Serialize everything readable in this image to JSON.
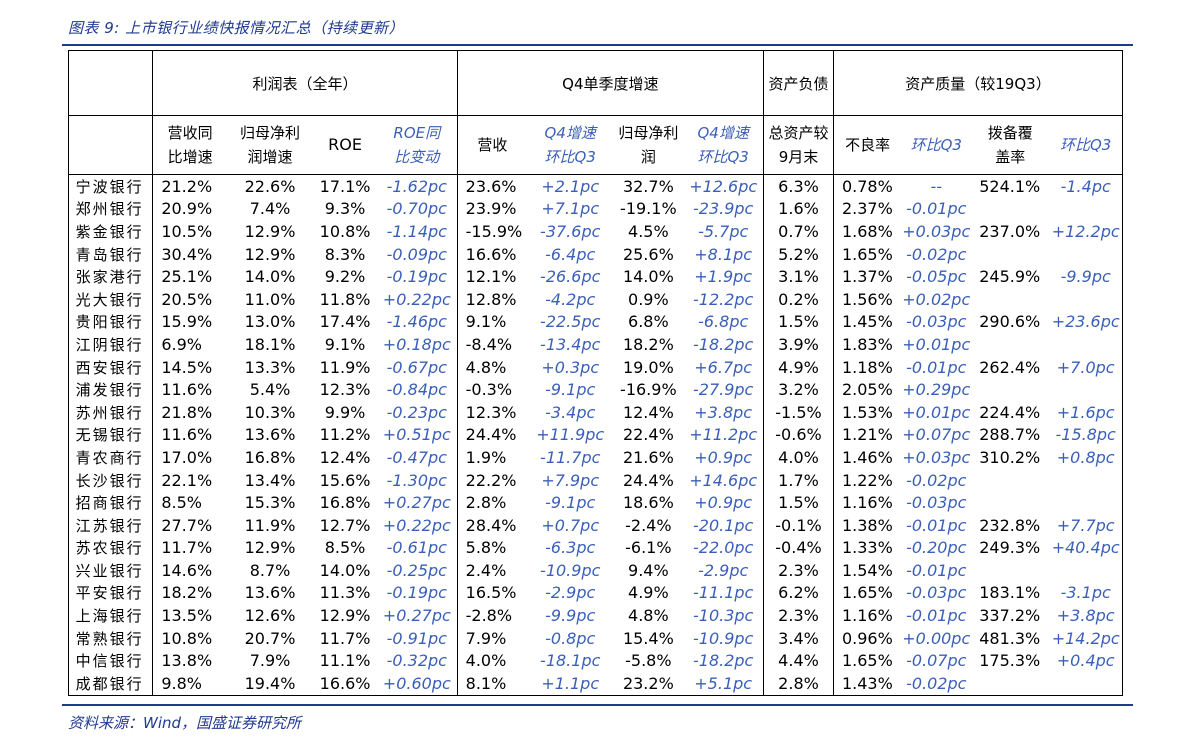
{
  "title": "图表 9:  上市银行业绩快报情况汇总（持续更新）",
  "source": "资料来源：Wind，国盛证券研究所",
  "groups": {
    "profit": "利润表（全年）",
    "q4": "Q4单季度增速",
    "balance": "资产负债",
    "quality": "资产质量（较19Q3）"
  },
  "columns": {
    "rev_yoy_1": "营收同",
    "rev_yoy_2": "比增速",
    "np_yoy_1": "归母净利",
    "np_yoy_2": "润增速",
    "roe": "ROE",
    "roe_yoy_1": "ROE同",
    "roe_yoy_2": "比变动",
    "q4_rev": "营收",
    "q4_rev_qoq_1": "Q4增速",
    "q4_rev_qoq_2": "环比Q3",
    "q4_np_1": "归母净利",
    "q4_np_2": "润",
    "q4_np_qoq_1": "Q4增速",
    "q4_np_qoq_2": "环比Q3",
    "assets_1": "总资产较",
    "assets_2": "9月末",
    "npl": "不良率",
    "npl_qoq": "环比Q3",
    "cov_1": "拨备覆",
    "cov_2": "盖率",
    "cov_qoq": "环比Q3"
  },
  "rows": [
    {
      "bank": "宁波银行",
      "c": [
        "21.2%",
        "22.6%",
        "17.1%",
        "-1.62pc",
        "23.6%",
        "+2.1pc",
        "32.7%",
        "+12.6pc",
        "6.3%",
        "0.78%",
        "--",
        "524.1%",
        "-1.4pc"
      ]
    },
    {
      "bank": "郑州银行",
      "c": [
        "20.9%",
        "7.4%",
        "9.3%",
        "-0.70pc",
        "23.9%",
        "+7.1pc",
        "-19.1%",
        "-23.9pc",
        "1.6%",
        "2.37%",
        "-0.01pc",
        "",
        ""
      ]
    },
    {
      "bank": "紫金银行",
      "c": [
        "10.5%",
        "12.9%",
        "10.8%",
        "-1.14pc",
        "-15.9%",
        "-37.6pc",
        "4.5%",
        "-5.7pc",
        "0.7%",
        "1.68%",
        "+0.03pc",
        "237.0%",
        "+12.2pc"
      ]
    },
    {
      "bank": "青岛银行",
      "c": [
        "30.4%",
        "12.9%",
        "8.3%",
        "-0.09pc",
        "16.6%",
        "-6.4pc",
        "25.6%",
        "+8.1pc",
        "5.2%",
        "1.65%",
        "-0.02pc",
        "",
        ""
      ]
    },
    {
      "bank": "张家港行",
      "c": [
        "25.1%",
        "14.0%",
        "9.2%",
        "-0.19pc",
        "12.1%",
        "-26.6pc",
        "14.0%",
        "+1.9pc",
        "3.1%",
        "1.37%",
        "-0.05pc",
        "245.9%",
        "-9.9pc"
      ]
    },
    {
      "bank": "光大银行",
      "c": [
        "20.5%",
        "11.0%",
        "11.8%",
        "+0.22pc",
        "12.8%",
        "-4.2pc",
        "0.9%",
        "-12.2pc",
        "0.2%",
        "1.56%",
        "+0.02pc",
        "",
        ""
      ]
    },
    {
      "bank": "贵阳银行",
      "c": [
        "15.9%",
        "13.0%",
        "17.4%",
        "-1.46pc",
        "9.1%",
        "-22.5pc",
        "6.8%",
        "-6.8pc",
        "1.5%",
        "1.45%",
        "-0.03pc",
        "290.6%",
        "+23.6pc"
      ]
    },
    {
      "bank": "江阴银行",
      "c": [
        "6.9%",
        "18.1%",
        "9.1%",
        "+0.18pc",
        "-8.4%",
        "-13.4pc",
        "18.2%",
        "-18.2pc",
        "3.9%",
        "1.83%",
        "+0.01pc",
        "",
        ""
      ]
    },
    {
      "bank": "西安银行",
      "c": [
        "14.5%",
        "13.3%",
        "11.9%",
        "-0.67pc",
        "4.8%",
        "+0.3pc",
        "19.0%",
        "+6.7pc",
        "4.9%",
        "1.18%",
        "-0.01pc",
        "262.4%",
        "+7.0pc"
      ]
    },
    {
      "bank": "浦发银行",
      "c": [
        "11.6%",
        "5.4%",
        "12.3%",
        "-0.84pc",
        "-0.3%",
        "-9.1pc",
        "-16.9%",
        "-27.9pc",
        "3.2%",
        "2.05%",
        "+0.29pc",
        "",
        ""
      ]
    },
    {
      "bank": "苏州银行",
      "c": [
        "21.8%",
        "10.3%",
        "9.9%",
        "-0.23pc",
        "12.3%",
        "-3.4pc",
        "12.4%",
        "+3.8pc",
        "-1.5%",
        "1.53%",
        "+0.01pc",
        "224.4%",
        "+1.6pc"
      ]
    },
    {
      "bank": "无锡银行",
      "c": [
        "11.6%",
        "13.6%",
        "11.2%",
        "+0.51pc",
        "24.4%",
        "+11.9pc",
        "22.4%",
        "+11.2pc",
        "-0.6%",
        "1.21%",
        "+0.07pc",
        "288.7%",
        "-15.8pc"
      ]
    },
    {
      "bank": "青农商行",
      "c": [
        "17.0%",
        "16.8%",
        "12.4%",
        "-0.47pc",
        "1.9%",
        "-11.7pc",
        "21.6%",
        "+0.9pc",
        "4.0%",
        "1.46%",
        "+0.03pc",
        "310.2%",
        "+0.8pc"
      ]
    },
    {
      "bank": "长沙银行",
      "c": [
        "22.1%",
        "13.4%",
        "15.6%",
        "-1.30pc",
        "22.2%",
        "+7.9pc",
        "24.4%",
        "+14.6pc",
        "1.7%",
        "1.22%",
        "-0.02pc",
        "",
        ""
      ]
    },
    {
      "bank": "招商银行",
      "c": [
        "8.5%",
        "15.3%",
        "16.8%",
        "+0.27pc",
        "2.8%",
        "-9.1pc",
        "18.6%",
        "+0.9pc",
        "1.5%",
        "1.16%",
        "-0.03pc",
        "",
        ""
      ]
    },
    {
      "bank": "江苏银行",
      "c": [
        "27.7%",
        "11.9%",
        "12.7%",
        "+0.22pc",
        "28.4%",
        "+0.7pc",
        "-2.4%",
        "-20.1pc",
        "-0.1%",
        "1.38%",
        "-0.01pc",
        "232.8%",
        "+7.7pc"
      ]
    },
    {
      "bank": "苏农银行",
      "c": [
        "11.7%",
        "12.9%",
        "8.5%",
        "-0.61pc",
        "5.8%",
        "-6.3pc",
        "-6.1%",
        "-22.0pc",
        "-0.4%",
        "1.33%",
        "-0.20pc",
        "249.3%",
        "+40.4pc"
      ]
    },
    {
      "bank": "兴业银行",
      "c": [
        "14.6%",
        "8.7%",
        "14.0%",
        "-0.25pc",
        "2.4%",
        "-10.9pc",
        "9.4%",
        "-2.9pc",
        "2.3%",
        "1.54%",
        "-0.01pc",
        "",
        ""
      ]
    },
    {
      "bank": "平安银行",
      "c": [
        "18.2%",
        "13.6%",
        "11.3%",
        "-0.19pc",
        "16.5%",
        "-2.9pc",
        "4.9%",
        "-11.1pc",
        "6.2%",
        "1.65%",
        "-0.03pc",
        "183.1%",
        "-3.1pc"
      ]
    },
    {
      "bank": "上海银行",
      "c": [
        "13.5%",
        "12.6%",
        "12.9%",
        "+0.27pc",
        "-2.8%",
        "-9.9pc",
        "4.8%",
        "-10.3pc",
        "2.3%",
        "1.16%",
        "-0.01pc",
        "337.2%",
        "+3.8pc"
      ]
    },
    {
      "bank": "常熟银行",
      "c": [
        "10.8%",
        "20.7%",
        "11.7%",
        "-0.91pc",
        "7.9%",
        "-0.8pc",
        "15.4%",
        "-10.9pc",
        "3.4%",
        "0.96%",
        "+0.00pc",
        "481.3%",
        "+14.2pc"
      ]
    },
    {
      "bank": "中信银行",
      "c": [
        "13.8%",
        "7.9%",
        "11.1%",
        "-0.32pc",
        "4.0%",
        "-18.1pc",
        "-5.8%",
        "-18.2pc",
        "4.4%",
        "1.65%",
        "-0.07pc",
        "175.3%",
        "+0.4pc"
      ]
    },
    {
      "bank": "成都银行",
      "c": [
        "9.8%",
        "19.4%",
        "16.6%",
        "+0.60pc",
        "8.1%",
        "+1.1pc",
        "23.2%",
        "+5.1pc",
        "2.8%",
        "1.43%",
        "-0.02pc",
        "",
        ""
      ]
    }
  ]
}
